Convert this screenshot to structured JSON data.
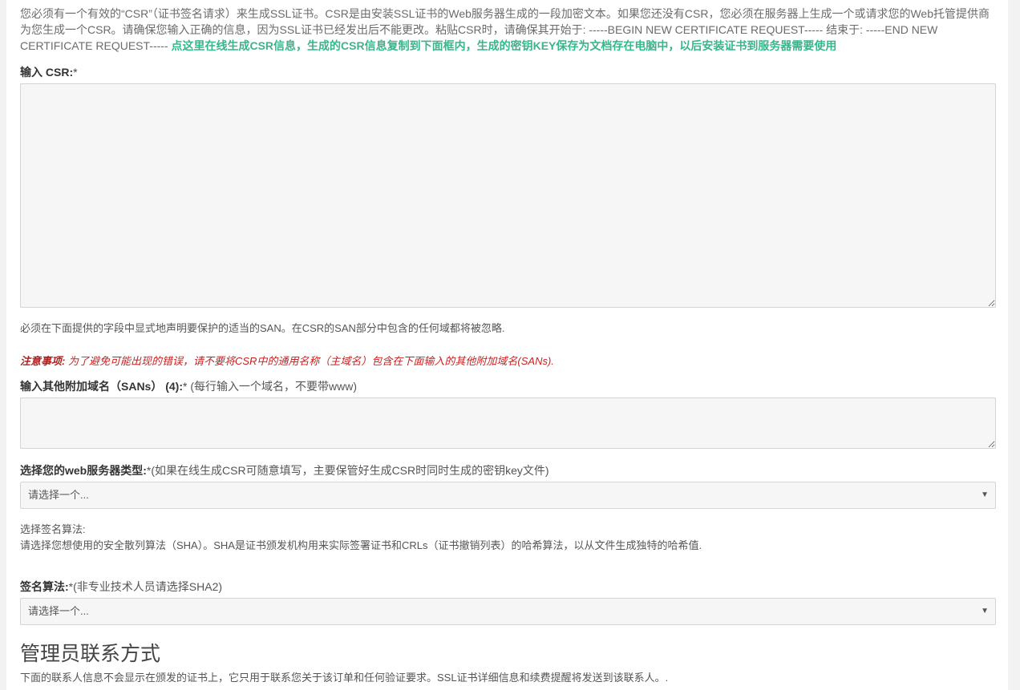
{
  "intro": {
    "text": "您必须有一个有效的“CSR”（证书签名请求）来生成SSL证书。CSR是由安装SSL证书的Web服务器生成的一段加密文本。如果您还没有CSR，您必须在服务器上生成一个或请求您的Web托管提供商为您生成一个CSR。请确保您输入正确的信息，因为SSL证书已经发出后不能更改。粘贴CSR时，请确保其开始于: -----BEGIN NEW CERTIFICATE REQUEST----- 结束于: -----END NEW CERTIFICATE REQUEST-----",
    "link": "点这里在线生成CSR信息，生成的CSR信息复制到下面框内，生成的密钥KEY保存为文档存在电脑中，以后安装证书到服务器需要使用"
  },
  "csr": {
    "label": "输入 CSR:",
    "required": "*"
  },
  "san_notice": "必须在下面提供的字段中显式地声明要保护的适当的SAN。在CSR的SAN部分中包含的任何域都将被忽略.",
  "warning": {
    "title": "注意事项:",
    "text": "为了避免可能出现的错误，请不要将CSR中的通用名称（主域名）包含在下面输入的其他附加域名(SANs)."
  },
  "sans": {
    "label": "输入其他附加域名（SANs） (4):",
    "required": "*",
    "note": "(每行输入一个域名，不要带www)"
  },
  "server_type": {
    "label": "选择您的web服务器类型:",
    "required": "*",
    "note": "(如果在线生成CSR可随意填写，主要保管好生成CSR时同时生成的密钥key文件)",
    "selected": "请选择一个...",
    "arrow": "▼"
  },
  "algo_info": {
    "title": "选择签名算法:",
    "text": "请选择您想使用的安全散列算法（SHA）。SHA是证书颁发机构用来实际签署证书和CRLs（证书撤销列表）的哈希算法，以从文件生成独特的哈希值."
  },
  "algo": {
    "label": "签名算法:",
    "required": "*",
    "note": "(非专业技术人员请选择SHA2)",
    "selected": "请选择一个...",
    "arrow": "▼"
  },
  "admin": {
    "heading": "管理员联系方式",
    "text": "下面的联系人信息不会显示在颁发的证书上，它只用于联系您关于该订单和任何验证要求。SSL证书详细信息和续费提醒将发送到该联系人。."
  }
}
